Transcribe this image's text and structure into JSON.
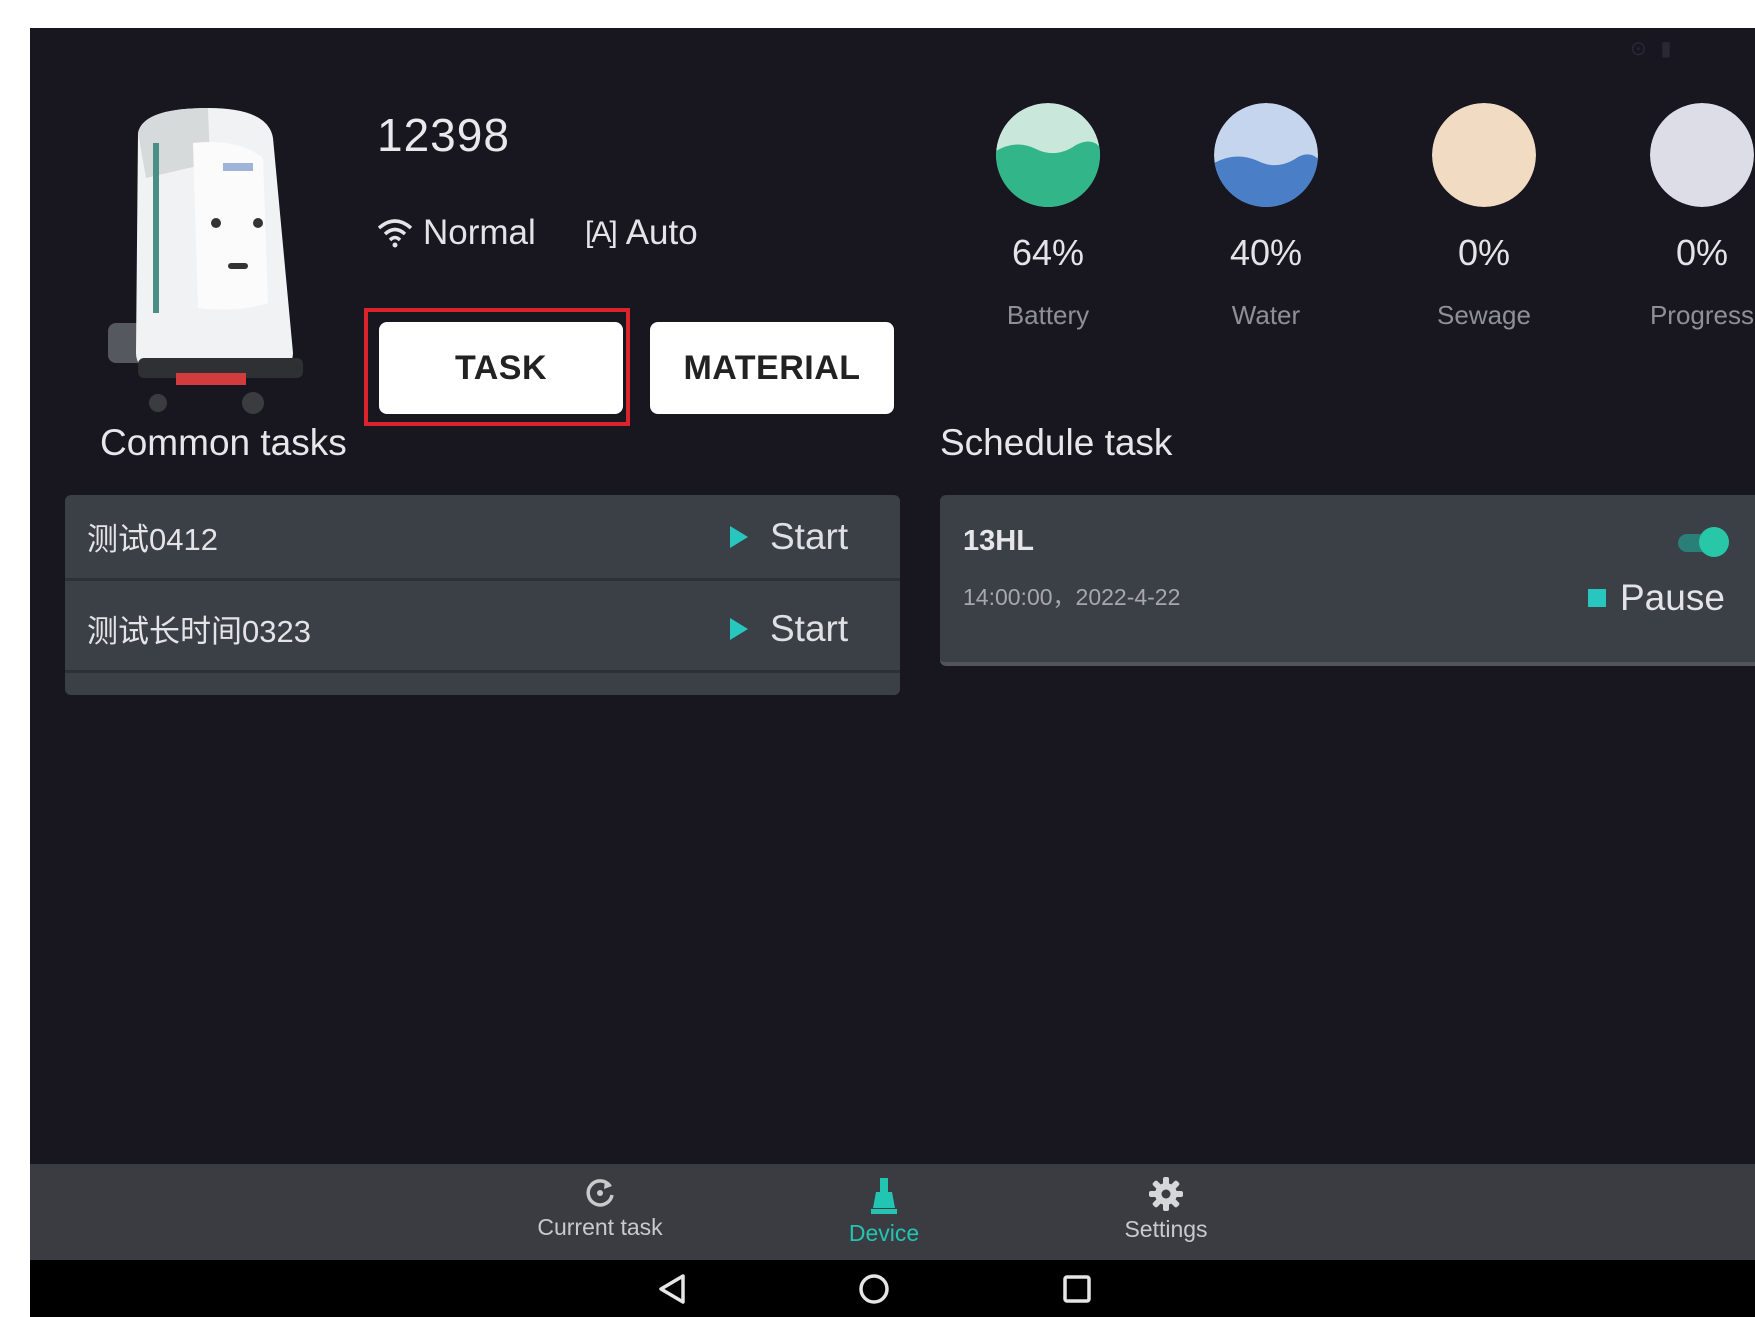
{
  "device": {
    "id": "12398",
    "network_label": "Normal",
    "mode_icon_glyph": "[A]",
    "mode_label": "Auto"
  },
  "tabs": {
    "task_label": "TASK",
    "material_label": "MATERIAL"
  },
  "gauges": {
    "battery": {
      "value": "64%",
      "label": "Battery",
      "color": "#33b58a"
    },
    "water": {
      "value": "40%",
      "label": "Water",
      "color": "#4a7fc8"
    },
    "sewage": {
      "value": "0%",
      "label": "Sewage",
      "color": "#f1dcc3"
    },
    "progress": {
      "value": "0%",
      "label": "Progress",
      "color": "#dcdde6"
    }
  },
  "common_tasks": {
    "title": "Common tasks",
    "items": [
      {
        "name": "测试0412",
        "action_label": "Start"
      },
      {
        "name": "测试长时间0323",
        "action_label": "Start"
      }
    ]
  },
  "schedule_task": {
    "title": "Schedule task",
    "item": {
      "name": "13HL",
      "time": "14:00:00，2022-4-22",
      "enabled": true,
      "action_label": "Pause"
    }
  },
  "bottom_nav": {
    "current_task_label": "Current task",
    "device_label": "Device",
    "settings_label": "Settings",
    "active": "device",
    "active_color": "#22c4b2"
  },
  "colors": {
    "background": "#181720",
    "card": "#3b3f46",
    "accent": "#27c7c0",
    "highlight_outline": "#d9242b"
  }
}
